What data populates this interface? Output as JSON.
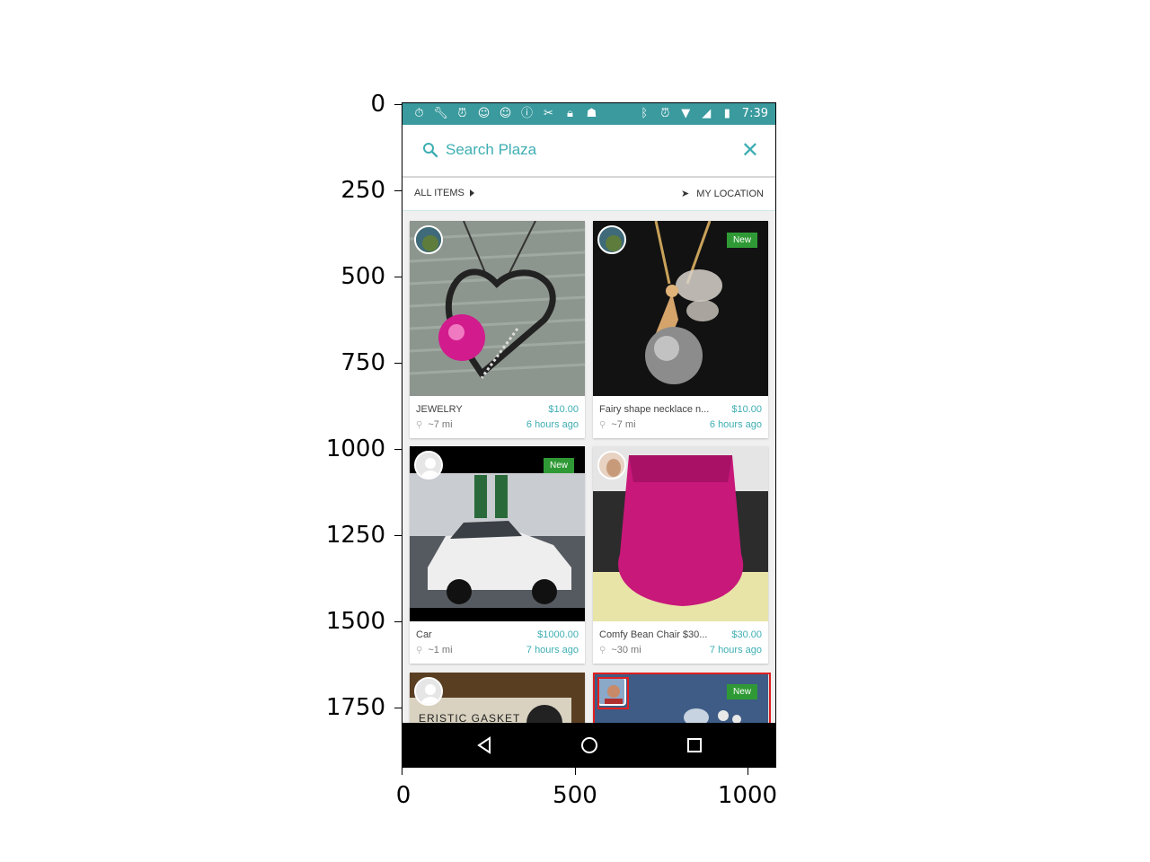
{
  "axes": {
    "y_ticks": [
      "0",
      "250",
      "500",
      "750",
      "1000",
      "1250",
      "1500",
      "1750"
    ],
    "x_ticks": [
      "0",
      "500",
      "1000"
    ]
  },
  "statusbar": {
    "time": "7:39",
    "icons_left": [
      "stopwatch-icon",
      "wrench-icon",
      "alarm-icon",
      "smiley-icon",
      "smiley-icon",
      "info-icon",
      "tools-icon",
      "lock-icon",
      "android-icon"
    ],
    "icons_right": [
      "bluetooth-icon",
      "alarm-icon",
      "wifi-icon",
      "signal-icon",
      "battery-icon"
    ]
  },
  "search": {
    "placeholder": "Search Plaza"
  },
  "filter": {
    "category": "ALL ITEMS",
    "location": "MY LOCATION"
  },
  "items": [
    {
      "title": "JEWELRY",
      "price": "$10.00",
      "distance": "~7 mi",
      "time": "6 hours ago",
      "is_new": false
    },
    {
      "title": "Fairy shape necklace n...",
      "price": "$10.00",
      "distance": "~7 mi",
      "time": "6 hours ago",
      "is_new": true,
      "badge": "New"
    },
    {
      "title": "Car",
      "price": "$1000.00",
      "distance": "~1 mi",
      "time": "7 hours ago",
      "is_new": true,
      "badge": "New"
    },
    {
      "title": "Comfy Bean Chair $30...",
      "price": "$30.00",
      "distance": "~30 mi",
      "time": "7 hours ago",
      "is_new": false
    },
    {
      "title": "",
      "image_text": "ERISTIC GASKET",
      "is_new": false
    },
    {
      "title": "",
      "is_new": true,
      "badge": "New"
    }
  ],
  "colors": {
    "accent": "#3eaeb3",
    "statusbar": "#3a9a9e",
    "badge": "#2f9a35",
    "highlight": "#e02020"
  }
}
